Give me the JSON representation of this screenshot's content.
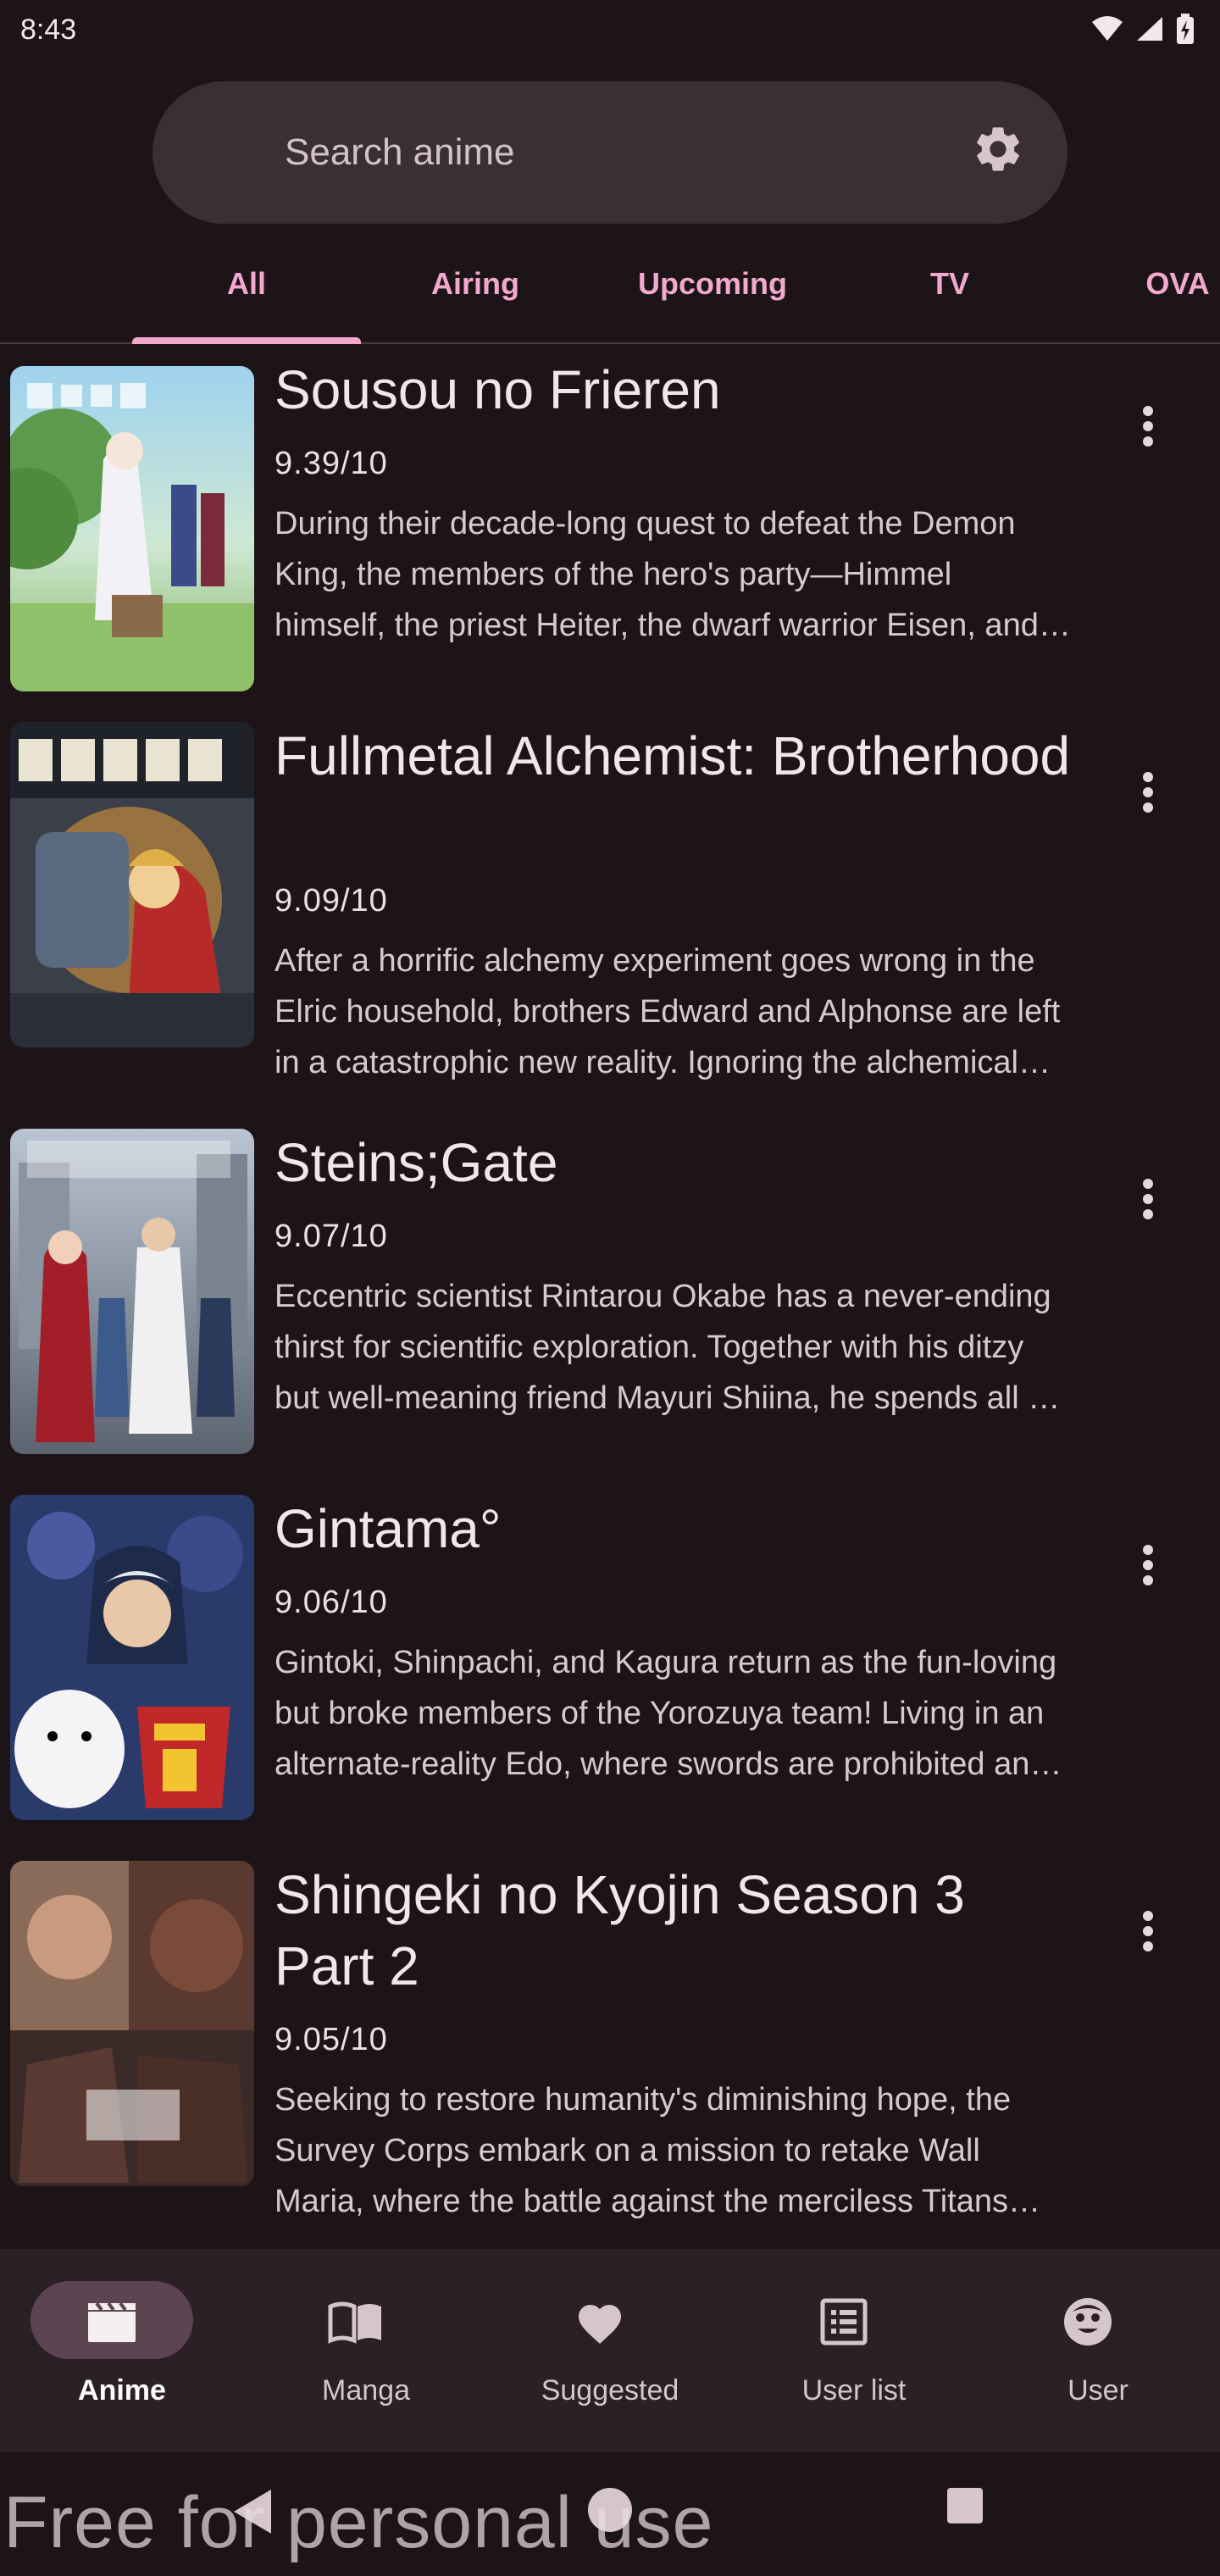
{
  "status_bar": {
    "time": "8:43",
    "icons": [
      "wifi-icon",
      "signal-icon",
      "battery-icon"
    ]
  },
  "search": {
    "placeholder": "Search anime",
    "value": "",
    "settings_icon": "gear-icon"
  },
  "tabs": [
    {
      "label": "All",
      "active": true
    },
    {
      "label": "Airing",
      "active": false
    },
    {
      "label": "Upcoming",
      "active": false
    },
    {
      "label": "TV",
      "active": false
    },
    {
      "label": "OVA",
      "active": false
    }
  ],
  "anime": [
    {
      "title": "Sousou no Frieren",
      "score": "9.39/10",
      "synopsis": "During their decade-long quest to defeat the Demon King, the members of the hero's party—Himmel himself, the priest Heiter, the dwarf warrior Eisen, and the elven mage Frieren—forge bonds through adventures and battles."
    },
    {
      "title": "Fullmetal Alchemist: Brotherhood",
      "score": "9.09/10",
      "synopsis": "After a horrific alchemy experiment goes wrong in the Elric household, brothers Edward and Alphonse are left in a catastrophic new reality. Ignoring the alchemical principle banning human transmutation, the boys attempted to bring their recently deceased mother back to life."
    },
    {
      "title": "Steins;Gate",
      "score": "9.07/10",
      "synopsis": "Eccentric scientist Rintarou Okabe has a never-ending thirst for scientific exploration. Together with his ditzy but well-meaning friend Mayuri Shiina, he spends all his time at the Future Gadget Laboratory."
    },
    {
      "title": "Gintama°",
      "score": "9.06/10",
      "synopsis": "Gintoki, Shinpachi, and Kagura return as the fun-loving but broke members of the Yorozuya team! Living in an alternate-reality Edo, where swords are prohibited and alien overlords have conquered Japan."
    },
    {
      "title": "Shingeki no Kyojin Season 3 Part 2",
      "score": "9.05/10",
      "synopsis": "Seeking to restore humanity's diminishing hope, the Survey Corps embark on a mission to retake Wall Maria, where the battle against the merciless Titans takes the stage once again."
    }
  ],
  "bottom_nav": [
    {
      "label": "Anime",
      "icon": "clapperboard-icon",
      "active": true
    },
    {
      "label": "Manga",
      "icon": "book-icon",
      "active": false
    },
    {
      "label": "Suggested",
      "icon": "heart-icon",
      "active": false
    },
    {
      "label": "User list",
      "icon": "list-icon",
      "active": false
    },
    {
      "label": "User",
      "icon": "face-icon",
      "active": false
    }
  ],
  "system_nav": [
    "back-icon",
    "home-icon",
    "recents-icon"
  ],
  "watermark": "Free for personal use",
  "colors": {
    "background": "#1d1418",
    "accent": "#f3a9ce",
    "search_bg": "#3a2f34",
    "nav_bg": "#2a2025",
    "nav_pill": "#5b4550"
  }
}
